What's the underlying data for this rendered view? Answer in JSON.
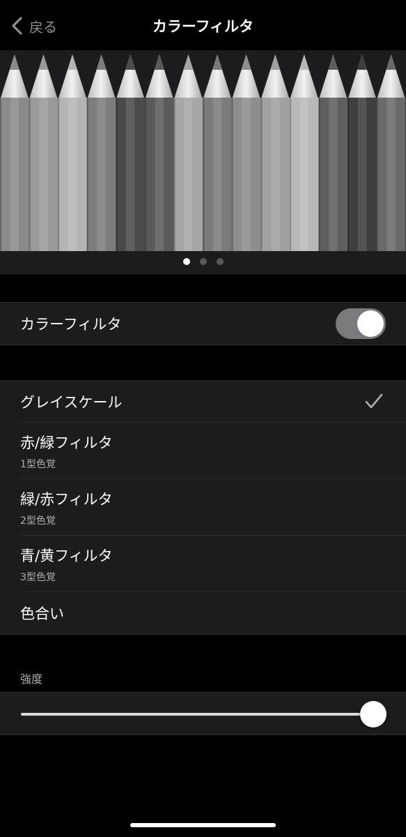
{
  "nav": {
    "back_label": "戻る",
    "title": "カラーフィルタ"
  },
  "preview": {
    "pages": 3,
    "active_page": 0
  },
  "toggle_row": {
    "label": "カラーフィルタ",
    "on": true
  },
  "filters": [
    {
      "label": "グレイスケール",
      "sublabel": "",
      "selected": true
    },
    {
      "label": "赤/緑フィルタ",
      "sublabel": "1型色覚",
      "selected": false
    },
    {
      "label": "緑/赤フィルタ",
      "sublabel": "2型色覚",
      "selected": false
    },
    {
      "label": "青/黄フィルタ",
      "sublabel": "3型色覚",
      "selected": false
    },
    {
      "label": "色合い",
      "sublabel": "",
      "selected": false
    }
  ],
  "intensity": {
    "label": "強度",
    "value": 1.0
  },
  "colors": {
    "background": "#000000",
    "cell": "#1c1c1e",
    "separator": "#2c2c2e",
    "secondary_text": "#aeaeb2",
    "toggle_track": "#7a7a7e"
  }
}
